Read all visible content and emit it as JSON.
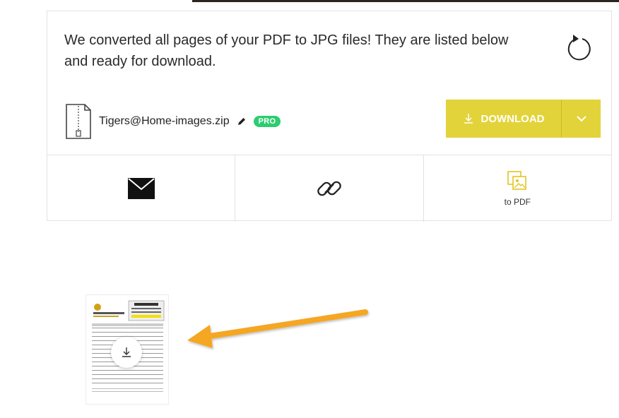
{
  "result": {
    "message": "We converted all pages of your PDF to JPG files! They are listed below and ready for download.",
    "file_name": "Tigers@Home-images.zip",
    "pro_badge": "PRO",
    "download_label": "DOWNLOAD"
  },
  "actions": {
    "email_icon": "envelope-icon",
    "link_icon": "link-icon",
    "to_pdf_label": "to PDF"
  },
  "colors": {
    "download_button": "#e3d33a",
    "pro_badge": "#2ecc71",
    "to_pdf_icon": "#e3c51f",
    "annotation_arrow": "#f5a623"
  }
}
